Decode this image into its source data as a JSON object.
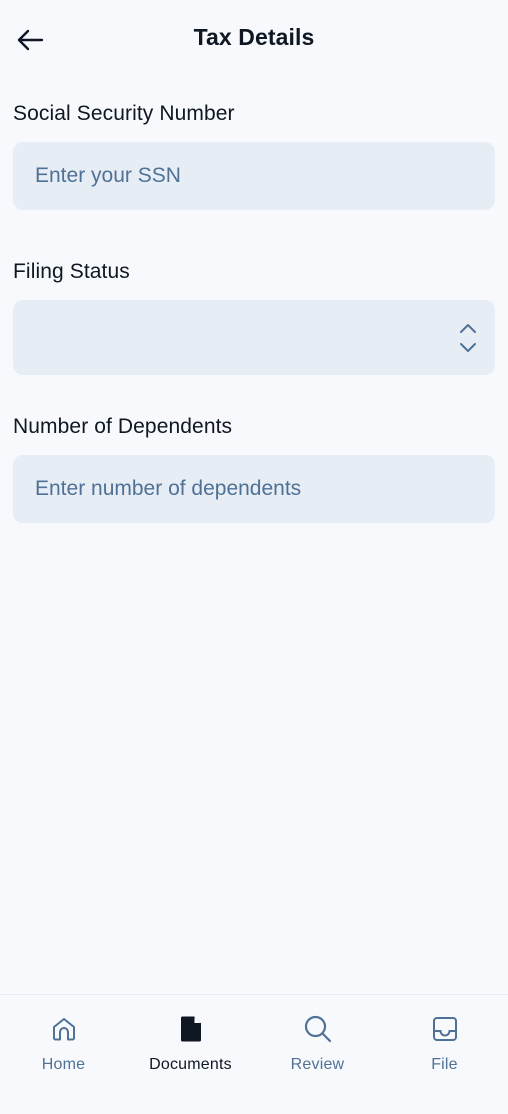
{
  "header": {
    "title": "Tax Details",
    "back_icon": "arrow-left-icon"
  },
  "form": {
    "ssn": {
      "label": "Social Security Number",
      "value": "",
      "placeholder": "Enter your SSN"
    },
    "filing_status": {
      "label": "Filing Status",
      "selected": "",
      "icon": "chevron-up-down-icon"
    },
    "dependents": {
      "label": "Number of Dependents",
      "value": "",
      "placeholder": "Enter number of dependents"
    }
  },
  "bottom_nav": {
    "items": [
      {
        "label": "Home",
        "icon": "home-icon",
        "active": false
      },
      {
        "label": "Documents",
        "icon": "document-icon",
        "active": true
      },
      {
        "label": "Review",
        "icon": "search-icon",
        "active": false
      },
      {
        "label": "File",
        "icon": "inbox-icon",
        "active": false
      }
    ]
  },
  "colors": {
    "background": "#f7f9fc",
    "input_bg": "#e7edf5",
    "placeholder": "#4f7196",
    "text": "#0e1722",
    "nav_inactive": "#4f7196"
  }
}
